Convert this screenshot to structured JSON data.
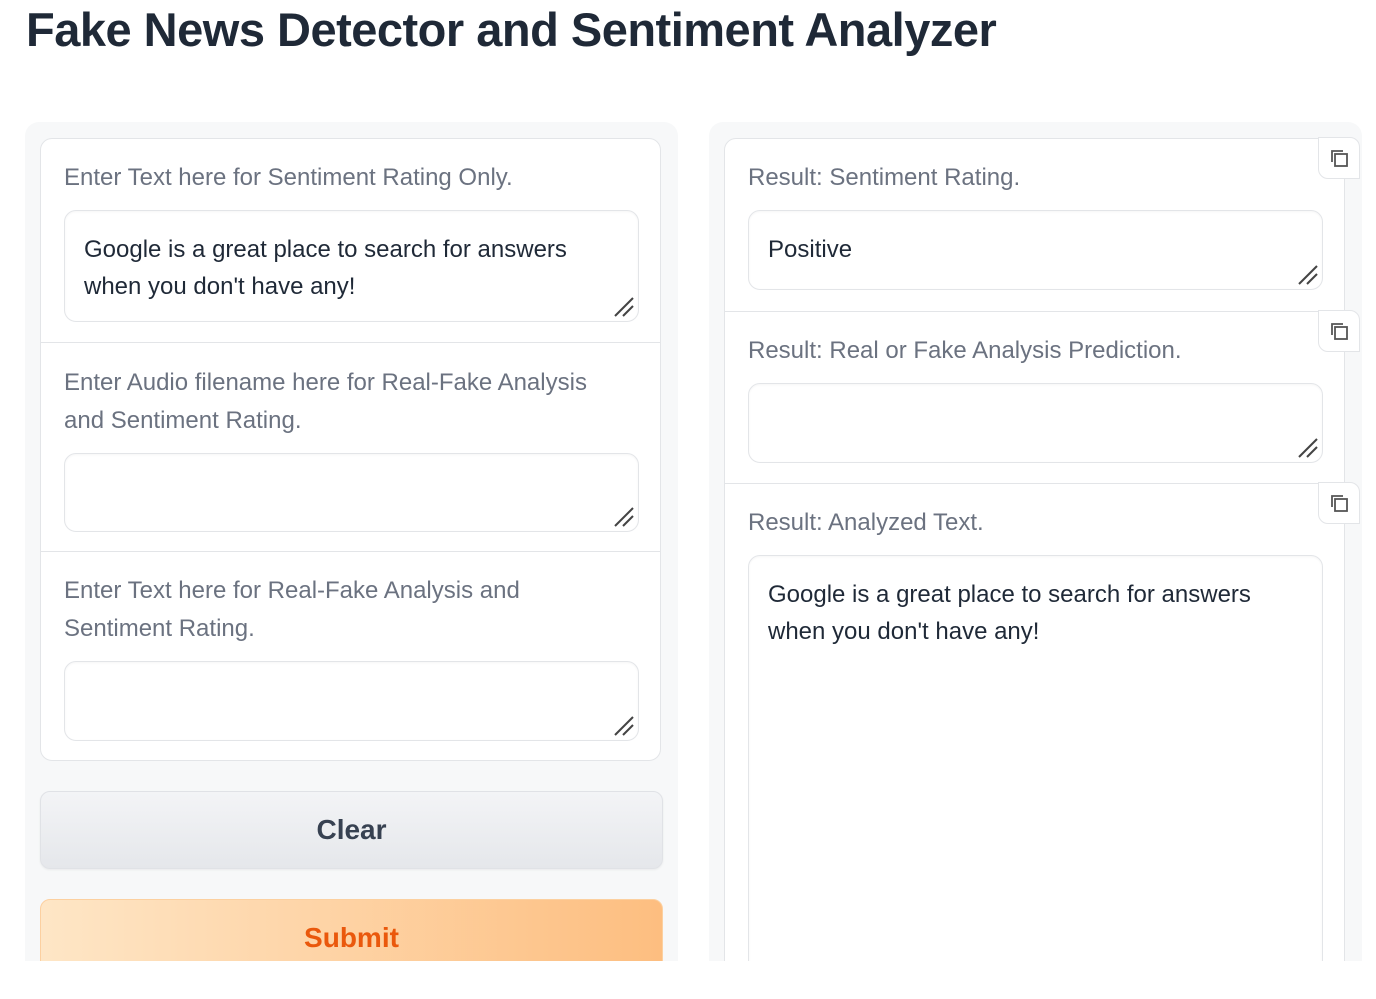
{
  "app": {
    "title": "Fake News Detector and Sentiment Analyzer"
  },
  "inputs": {
    "sentiment_text": {
      "label": "Enter Text here for Sentiment Rating Only.",
      "value": "Google is a great place to search for answers when you don't have any!"
    },
    "audio_filename": {
      "label": "Enter Audio filename here for Real-Fake Analysis and Sentiment Rating.",
      "value": ""
    },
    "realfake_text": {
      "label": "Enter Text here for Real-Fake Analysis and Sentiment Rating.",
      "value": ""
    }
  },
  "buttons": {
    "clear_label": "Clear",
    "submit_label": "Submit"
  },
  "outputs": {
    "sentiment": {
      "label": "Result: Sentiment Rating.",
      "value": "Positive"
    },
    "realfake": {
      "label": "Result: Real or Fake Analysis Prediction.",
      "value": ""
    },
    "analyzed_text": {
      "label": "Result: Analyzed Text.",
      "value": "Google is a great place to search for answers when you don't have any!"
    }
  },
  "icons": {
    "copy": "copy-icon",
    "resize": "resize-handle-icon"
  },
  "colors": {
    "accent": "#ea580c",
    "submit_start": "#fee6c6",
    "submit_end": "#fdbe80",
    "label": "#6b7280"
  }
}
